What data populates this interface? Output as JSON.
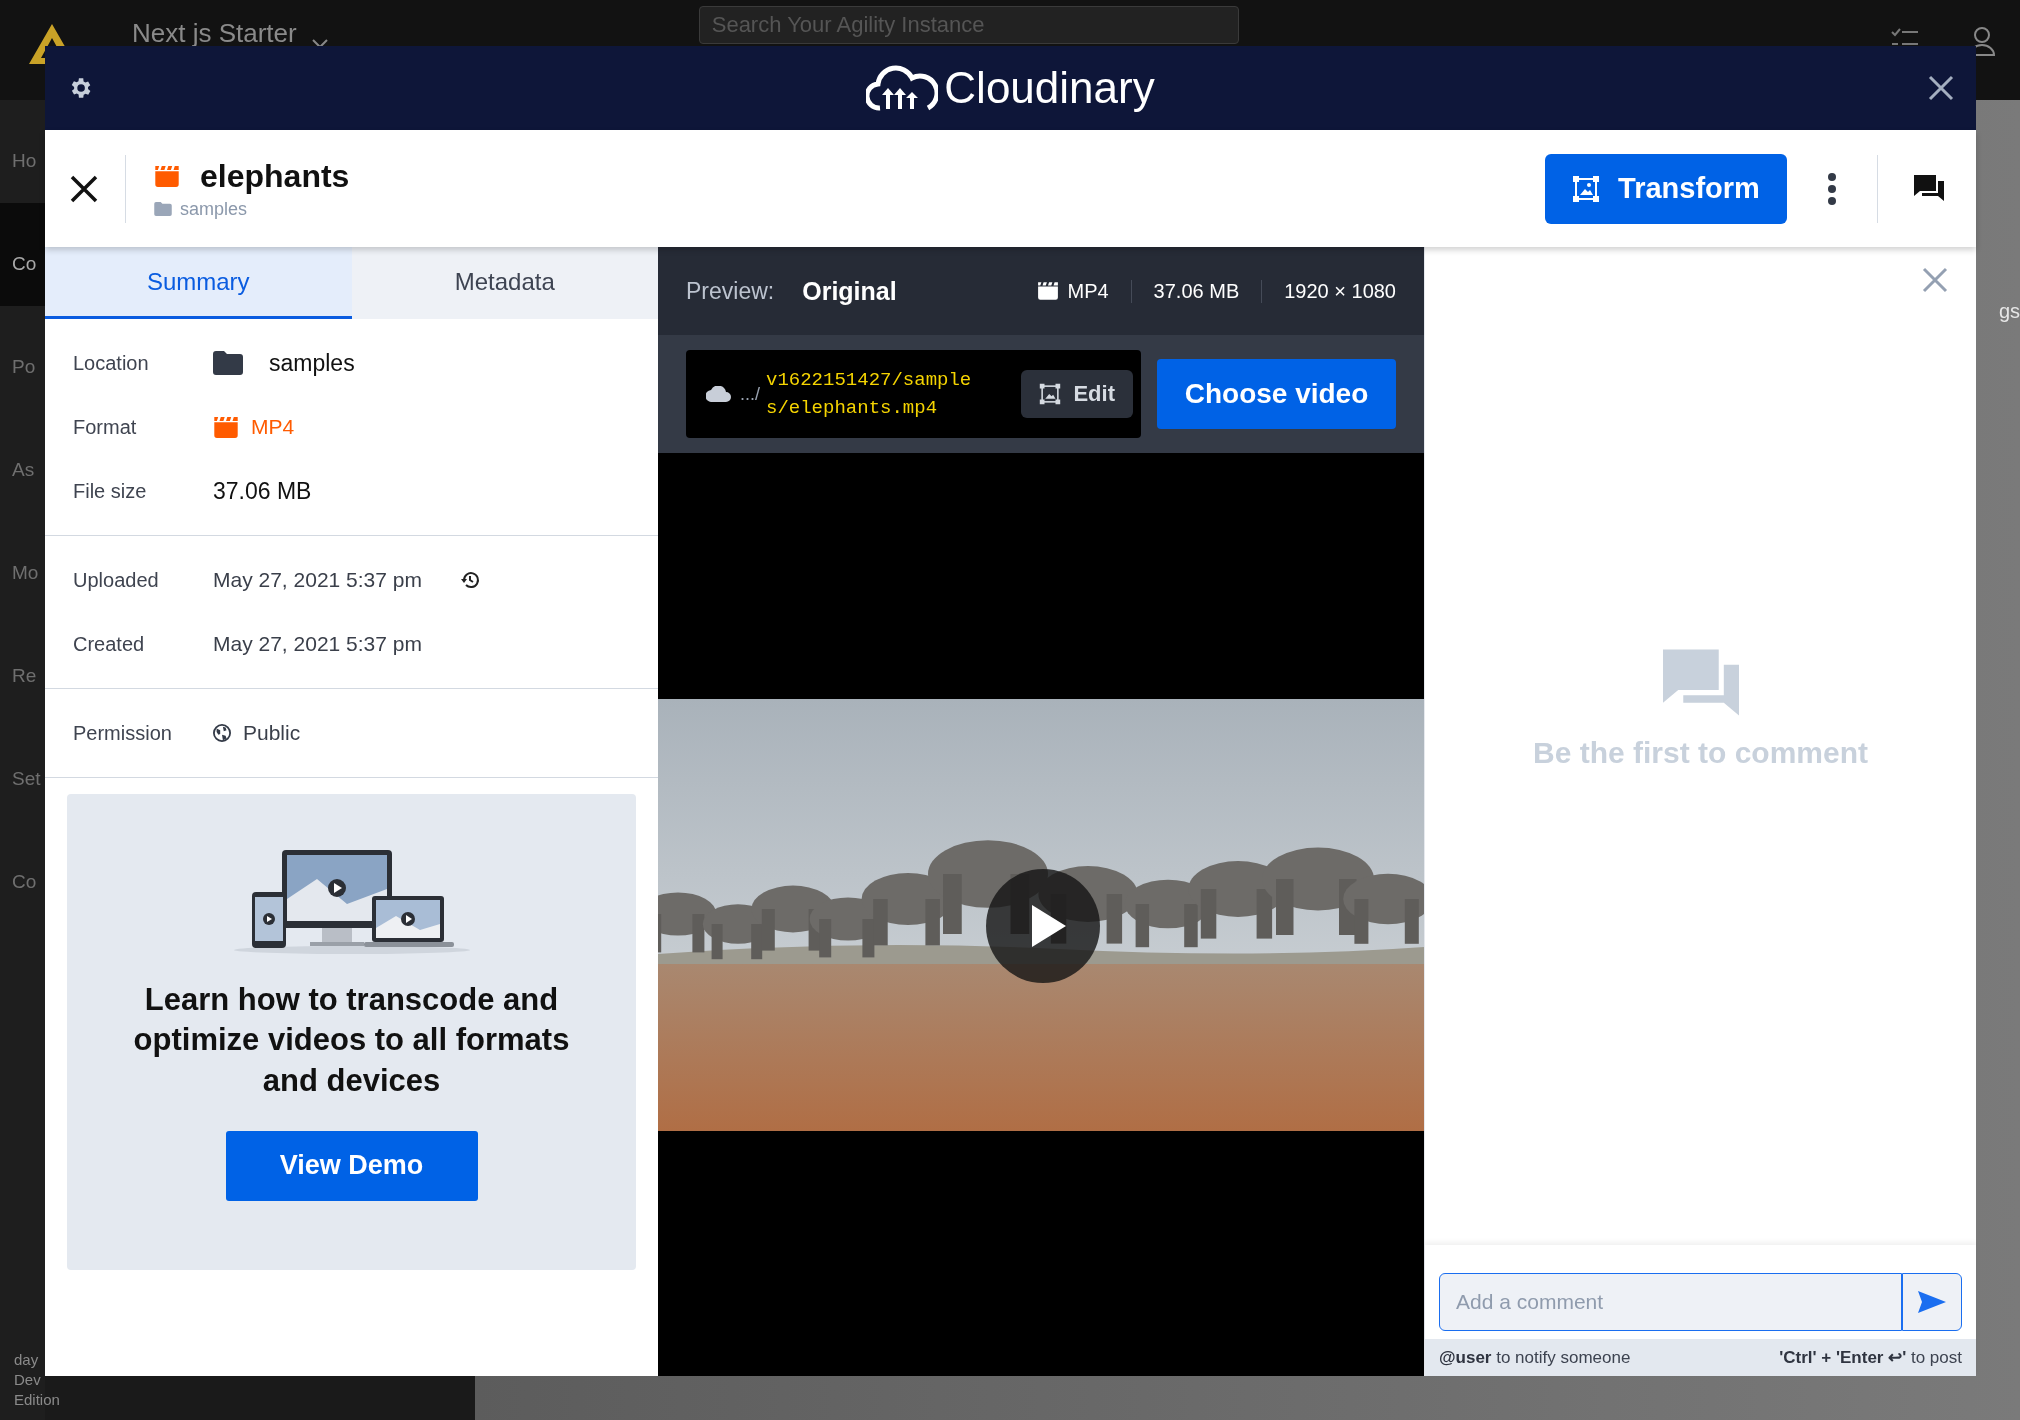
{
  "app": {
    "title": "Next js Starter",
    "search": {
      "placeholder": "Search Your Agility Instance"
    },
    "nav": [
      {
        "label": "Ho",
        "selected": false
      },
      {
        "label": "Co",
        "selected": true
      },
      {
        "label": "Po",
        "selected": false
      },
      {
        "label": "As",
        "selected": false
      },
      {
        "label": "Mo",
        "selected": false
      },
      {
        "label": "Re",
        "selected": false
      },
      {
        "label": "Set",
        "selected": false
      },
      {
        "label": "Co",
        "selected": false
      }
    ],
    "footer": [
      "day",
      "Dev",
      "Edition"
    ],
    "right_fragment": "gs"
  },
  "modal": {
    "brand": "Cloudinary"
  },
  "asset": {
    "name": "elephants",
    "folder": "samples",
    "transform": "Transform"
  },
  "tabs": [
    {
      "label": "Summary",
      "selected": true
    },
    {
      "label": "Metadata",
      "selected": false
    }
  ],
  "details": [
    [
      {
        "label": "Location",
        "value": "samples",
        "kind": "folder"
      },
      {
        "label": "Format",
        "value": "MP4",
        "kind": "format"
      },
      {
        "label": "File size",
        "value": "37.06 MB",
        "kind": "plain"
      }
    ],
    [
      {
        "label": "Uploaded",
        "value": "May 27, 2021 5:37 pm",
        "kind": "history"
      },
      {
        "label": "Created",
        "value": "May 27, 2021 5:37 pm",
        "kind": "plain"
      }
    ],
    [
      {
        "label": "Permission",
        "value": "Public",
        "kind": "globe"
      }
    ]
  ],
  "promo": {
    "title": "Learn how to transcode and optimize videos to all formats and devices",
    "button": "View Demo"
  },
  "preview": {
    "label": "Preview:",
    "version": "Original",
    "format": "MP4",
    "size": "37.06 MB",
    "dimensions": "1920 × 1080",
    "path_prefix": ".../",
    "path": "v1622151427/samples/elephants.mp4",
    "edit": "Edit",
    "choose": "Choose video"
  },
  "comments": {
    "empty": "Be the first to comment",
    "placeholder": "Add a comment",
    "hint_left": "**@user** to notify someone",
    "hint_right": "**'Ctrl' + 'Enter ↩'** to post"
  }
}
